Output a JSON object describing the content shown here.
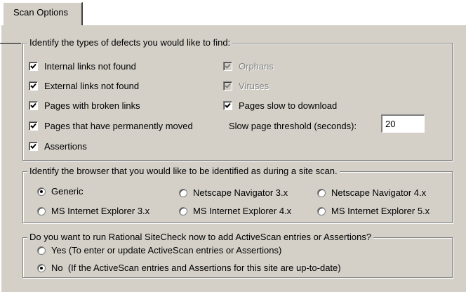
{
  "tab": {
    "label": "Scan Options"
  },
  "defects": {
    "legend": "Identify the types of defects you would like to find:",
    "items": [
      {
        "label": "Internal links not found",
        "checked": true,
        "enabled": true
      },
      {
        "label": "External links not found",
        "checked": true,
        "enabled": true
      },
      {
        "label": "Pages with broken links",
        "checked": true,
        "enabled": true
      },
      {
        "label": "Pages that have permanently moved",
        "checked": true,
        "enabled": true
      },
      {
        "label": "Assertions",
        "checked": true,
        "enabled": true
      },
      {
        "label": "Orphans",
        "checked": true,
        "enabled": false
      },
      {
        "label": "Viruses",
        "checked": true,
        "enabled": false
      },
      {
        "label": "Pages slow to download",
        "checked": true,
        "enabled": true
      }
    ],
    "threshold_label": "Slow page threshold (seconds):",
    "threshold_value": "20"
  },
  "browser": {
    "legend": "Identify the browser that you would like to be identified as during a site scan.",
    "options": [
      {
        "label": "Generic",
        "selected": true
      },
      {
        "label": "Netscape Navigator 3.x",
        "selected": false
      },
      {
        "label": "Netscape Navigator 4.x",
        "selected": false
      },
      {
        "label": "MS Internet Explorer 3.x",
        "selected": false
      },
      {
        "label": "MS Internet Explorer 4.x",
        "selected": false
      },
      {
        "label": "MS Internet Explorer 5.x",
        "selected": false
      }
    ]
  },
  "sitecheck": {
    "legend": "Do you want to run Rational SiteCheck now to add ActiveScan entries or Assertions?",
    "options": [
      {
        "label": "Yes (To enter or update ActiveScan entries or Assertions)",
        "selected": false
      },
      {
        "label": "No  (If the ActiveScan entries and Assertions for this site are up-to-date)",
        "selected": true
      }
    ]
  }
}
